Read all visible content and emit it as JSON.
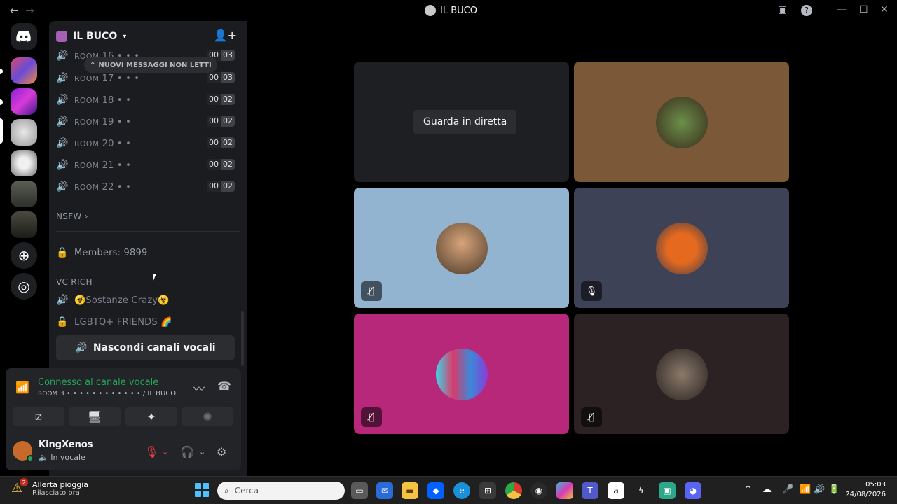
{
  "window": {
    "title": "IL BUCO",
    "back_icon": "←",
    "forward_icon": "→"
  },
  "server": {
    "name": "IL BUCO"
  },
  "unread_banner": "NUOVI MESSAGGI NON LETTI",
  "channels": [
    {
      "prefix": "ROOM",
      "name": "16 • • •",
      "c1": "00",
      "c2": "03"
    },
    {
      "prefix": "ROOM",
      "name": "17 • • •",
      "c1": "00",
      "c2": "03"
    },
    {
      "prefix": "ROOM",
      "name": "18 • •",
      "c1": "00",
      "c2": "02"
    },
    {
      "prefix": "ROOM",
      "name": "19 • •",
      "c1": "00",
      "c2": "02"
    },
    {
      "prefix": "ROOM",
      "name": "20 • •",
      "c1": "00",
      "c2": "02"
    },
    {
      "prefix": "ROOM",
      "name": "21 • •",
      "c1": "00",
      "c2": "02"
    },
    {
      "prefix": "ROOM",
      "name": "22 • •",
      "c1": "00",
      "c2": "02"
    }
  ],
  "category_nsfw": "NSFW",
  "members_channel": "Members: 9899",
  "category_vc_rich": "VC RICH",
  "channel_sostanze": "☣️Sostanze Crazy☣️",
  "channel_lgbtq": "LGBTQ+ FRIENDS 🌈",
  "hide_voice_button": "Nascondi canali vocali",
  "voice_panel": {
    "status": "Connesso al canale vocale",
    "sub_prefix": "ROOM",
    "sub": "3 • • • • • • • • • • • • / IL BUCO"
  },
  "user": {
    "name": "KingXenos",
    "status": "In vocale"
  },
  "stage": {
    "live_button": "Guarda in diretta"
  },
  "taskbar": {
    "weather_title": "Allerta pioggia",
    "weather_sub": "Rilasciato ora",
    "weather_badge": "2",
    "search_placeholder": "Cerca",
    "time": "05:03",
    "date": "24/08/2026"
  },
  "colors": {
    "tile_brown": "#7a5838",
    "tile_lightblue": "#93b4d0",
    "tile_slate": "#3e4256",
    "tile_magenta": "#b8287a",
    "tile_darkred": "#2c2224",
    "tile_dark": "#1e1f22",
    "accent_green": "#23a55a"
  }
}
